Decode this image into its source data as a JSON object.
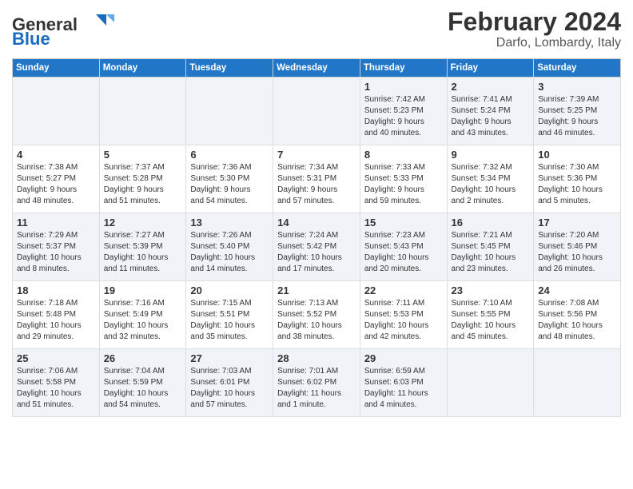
{
  "logo": {
    "text_general": "General",
    "text_blue": "Blue"
  },
  "title": "February 2024",
  "subtitle": "Darfo, Lombardy, Italy",
  "days_of_week": [
    "Sunday",
    "Monday",
    "Tuesday",
    "Wednesday",
    "Thursday",
    "Friday",
    "Saturday"
  ],
  "weeks": [
    [
      {
        "day": "",
        "info": ""
      },
      {
        "day": "",
        "info": ""
      },
      {
        "day": "",
        "info": ""
      },
      {
        "day": "",
        "info": ""
      },
      {
        "day": "1",
        "info": "Sunrise: 7:42 AM\nSunset: 5:23 PM\nDaylight: 9 hours\nand 40 minutes."
      },
      {
        "day": "2",
        "info": "Sunrise: 7:41 AM\nSunset: 5:24 PM\nDaylight: 9 hours\nand 43 minutes."
      },
      {
        "day": "3",
        "info": "Sunrise: 7:39 AM\nSunset: 5:25 PM\nDaylight: 9 hours\nand 46 minutes."
      }
    ],
    [
      {
        "day": "4",
        "info": "Sunrise: 7:38 AM\nSunset: 5:27 PM\nDaylight: 9 hours\nand 48 minutes."
      },
      {
        "day": "5",
        "info": "Sunrise: 7:37 AM\nSunset: 5:28 PM\nDaylight: 9 hours\nand 51 minutes."
      },
      {
        "day": "6",
        "info": "Sunrise: 7:36 AM\nSunset: 5:30 PM\nDaylight: 9 hours\nand 54 minutes."
      },
      {
        "day": "7",
        "info": "Sunrise: 7:34 AM\nSunset: 5:31 PM\nDaylight: 9 hours\nand 57 minutes."
      },
      {
        "day": "8",
        "info": "Sunrise: 7:33 AM\nSunset: 5:33 PM\nDaylight: 9 hours\nand 59 minutes."
      },
      {
        "day": "9",
        "info": "Sunrise: 7:32 AM\nSunset: 5:34 PM\nDaylight: 10 hours\nand 2 minutes."
      },
      {
        "day": "10",
        "info": "Sunrise: 7:30 AM\nSunset: 5:36 PM\nDaylight: 10 hours\nand 5 minutes."
      }
    ],
    [
      {
        "day": "11",
        "info": "Sunrise: 7:29 AM\nSunset: 5:37 PM\nDaylight: 10 hours\nand 8 minutes."
      },
      {
        "day": "12",
        "info": "Sunrise: 7:27 AM\nSunset: 5:39 PM\nDaylight: 10 hours\nand 11 minutes."
      },
      {
        "day": "13",
        "info": "Sunrise: 7:26 AM\nSunset: 5:40 PM\nDaylight: 10 hours\nand 14 minutes."
      },
      {
        "day": "14",
        "info": "Sunrise: 7:24 AM\nSunset: 5:42 PM\nDaylight: 10 hours\nand 17 minutes."
      },
      {
        "day": "15",
        "info": "Sunrise: 7:23 AM\nSunset: 5:43 PM\nDaylight: 10 hours\nand 20 minutes."
      },
      {
        "day": "16",
        "info": "Sunrise: 7:21 AM\nSunset: 5:45 PM\nDaylight: 10 hours\nand 23 minutes."
      },
      {
        "day": "17",
        "info": "Sunrise: 7:20 AM\nSunset: 5:46 PM\nDaylight: 10 hours\nand 26 minutes."
      }
    ],
    [
      {
        "day": "18",
        "info": "Sunrise: 7:18 AM\nSunset: 5:48 PM\nDaylight: 10 hours\nand 29 minutes."
      },
      {
        "day": "19",
        "info": "Sunrise: 7:16 AM\nSunset: 5:49 PM\nDaylight: 10 hours\nand 32 minutes."
      },
      {
        "day": "20",
        "info": "Sunrise: 7:15 AM\nSunset: 5:51 PM\nDaylight: 10 hours\nand 35 minutes."
      },
      {
        "day": "21",
        "info": "Sunrise: 7:13 AM\nSunset: 5:52 PM\nDaylight: 10 hours\nand 38 minutes."
      },
      {
        "day": "22",
        "info": "Sunrise: 7:11 AM\nSunset: 5:53 PM\nDaylight: 10 hours\nand 42 minutes."
      },
      {
        "day": "23",
        "info": "Sunrise: 7:10 AM\nSunset: 5:55 PM\nDaylight: 10 hours\nand 45 minutes."
      },
      {
        "day": "24",
        "info": "Sunrise: 7:08 AM\nSunset: 5:56 PM\nDaylight: 10 hours\nand 48 minutes."
      }
    ],
    [
      {
        "day": "25",
        "info": "Sunrise: 7:06 AM\nSunset: 5:58 PM\nDaylight: 10 hours\nand 51 minutes."
      },
      {
        "day": "26",
        "info": "Sunrise: 7:04 AM\nSunset: 5:59 PM\nDaylight: 10 hours\nand 54 minutes."
      },
      {
        "day": "27",
        "info": "Sunrise: 7:03 AM\nSunset: 6:01 PM\nDaylight: 10 hours\nand 57 minutes."
      },
      {
        "day": "28",
        "info": "Sunrise: 7:01 AM\nSunset: 6:02 PM\nDaylight: 11 hours\nand 1 minute."
      },
      {
        "day": "29",
        "info": "Sunrise: 6:59 AM\nSunset: 6:03 PM\nDaylight: 11 hours\nand 4 minutes."
      },
      {
        "day": "",
        "info": ""
      },
      {
        "day": "",
        "info": ""
      }
    ]
  ]
}
